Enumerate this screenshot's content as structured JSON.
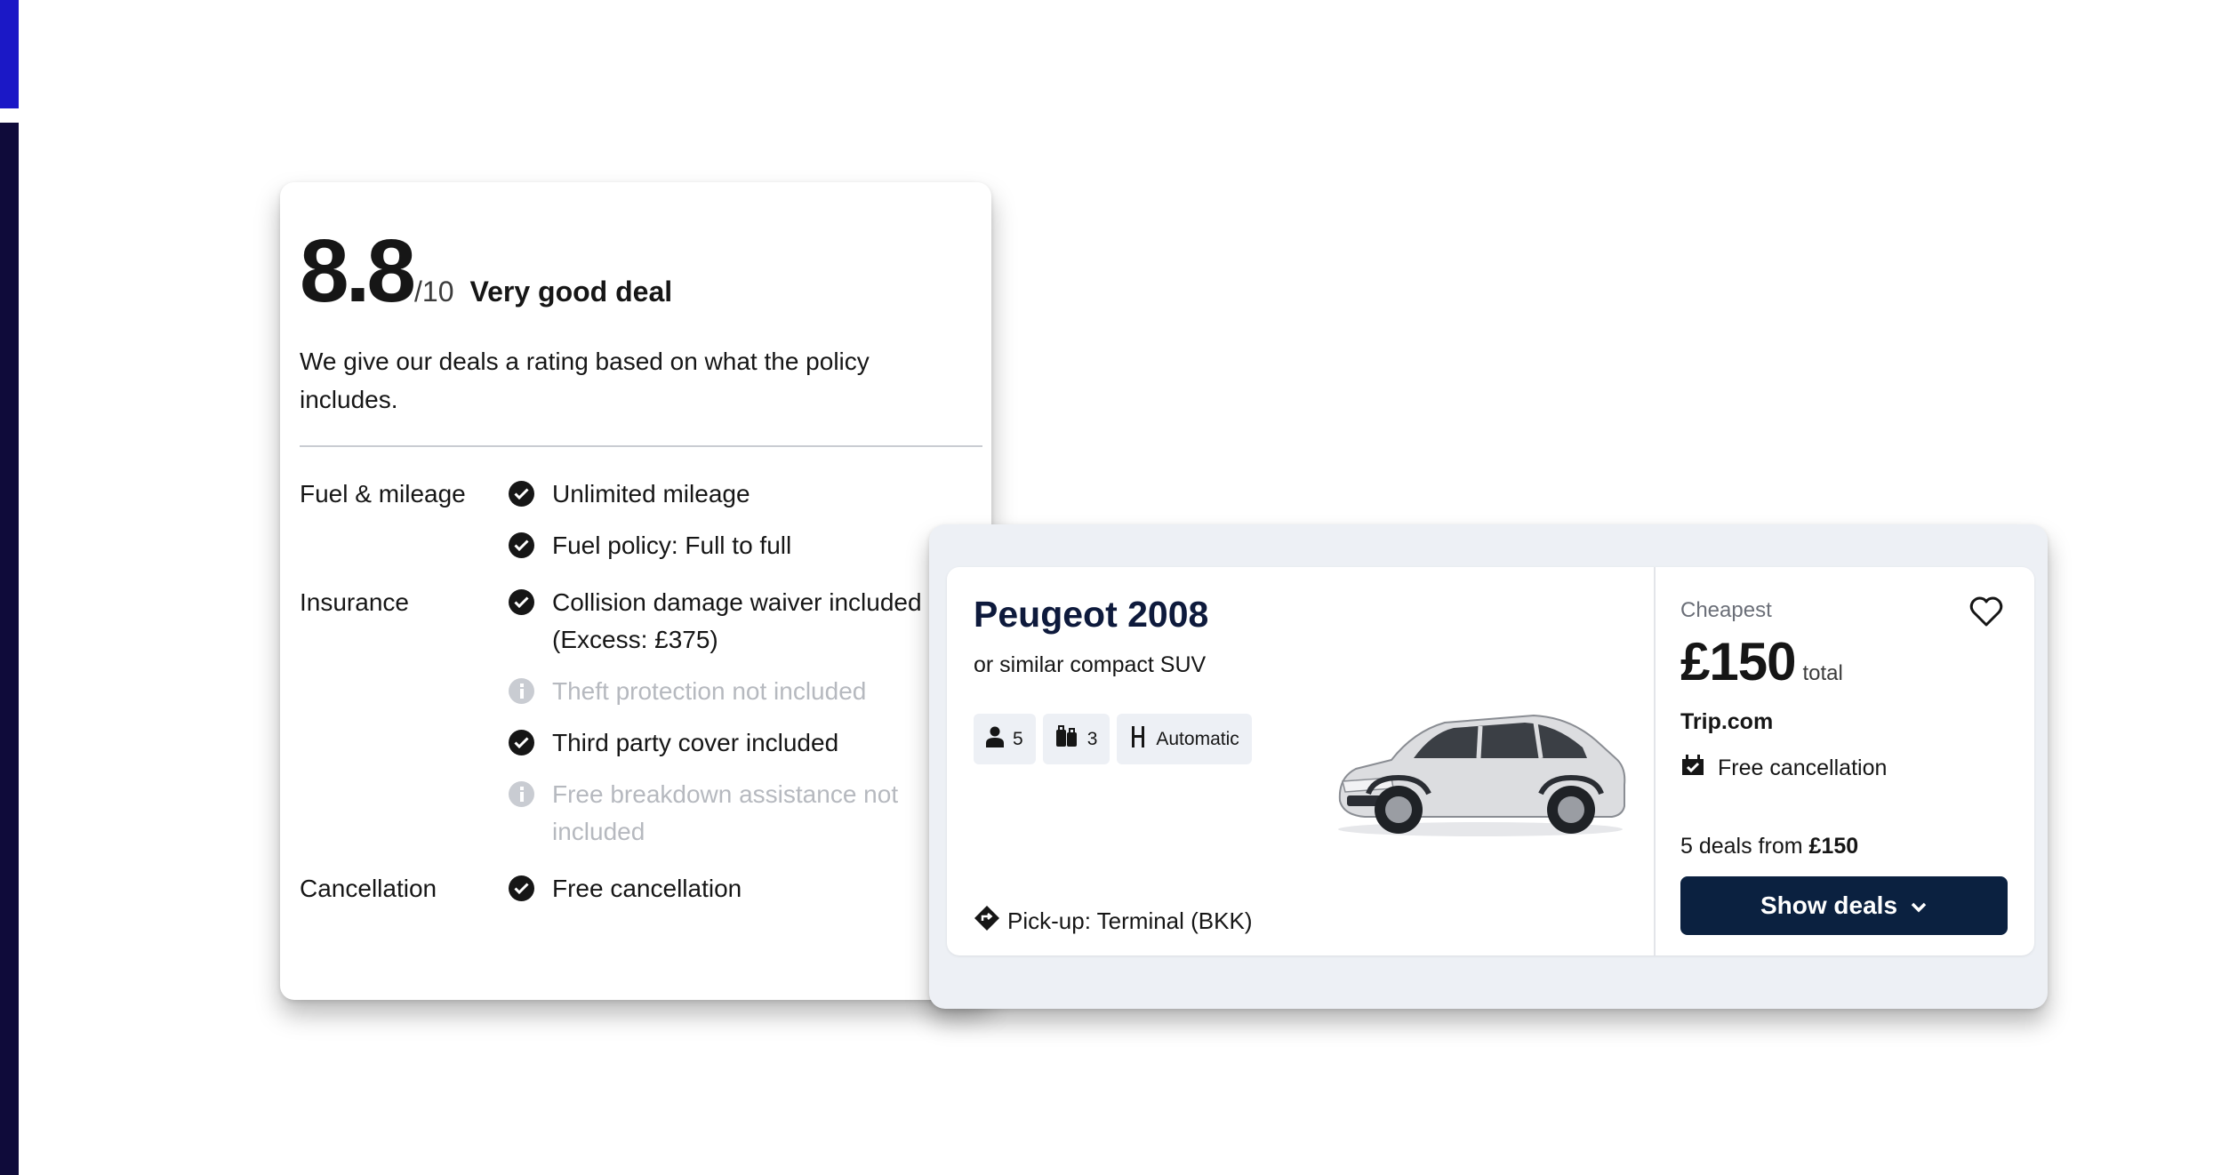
{
  "rating": {
    "score": "8.8",
    "max": "/10",
    "label": "Very good deal",
    "description": "We give our deals a rating based on what the policy includes."
  },
  "features": {
    "fuel": {
      "category": "Fuel & mileage",
      "items": [
        "Unlimited mileage",
        "Fuel policy: Full to full"
      ]
    },
    "insurance": {
      "category": "Insurance",
      "items": [
        "Collision damage waiver included (Excess: £375)",
        "Theft protection not included",
        "Third party cover included",
        "Free breakdown assistance not included"
      ]
    },
    "cancellation": {
      "category": "Cancellation",
      "items": [
        "Free cancellation"
      ]
    }
  },
  "deal": {
    "car_name": "Peugeot 2008",
    "car_subtitle": "or similar compact SUV",
    "specs": {
      "seats": "5",
      "bags": "3",
      "transmission": "Automatic"
    },
    "pickup": "Pick-up: Terminal (BKK)",
    "cheapest_label": "Cheapest",
    "price": "£150",
    "price_suffix": "total",
    "provider": "Trip.com",
    "free_cancellation": "Free cancellation",
    "deals_count_text": "5 deals from ",
    "deals_count_price": "£150",
    "button_label": "Show deals"
  },
  "icons": {
    "check": "check-circle-icon",
    "info": "info-circle-icon",
    "heart": "heart-icon",
    "seat": "person-icon",
    "bag": "luggage-icon",
    "transmission": "gearshift-icon",
    "pickup": "location-diamond-icon",
    "cancel": "calendar-check-icon",
    "chevron": "chevron-down-icon"
  },
  "colors": {
    "brand_blue": "#1b18c6",
    "navy": "#0f0b3a",
    "button": "#0b2140"
  }
}
